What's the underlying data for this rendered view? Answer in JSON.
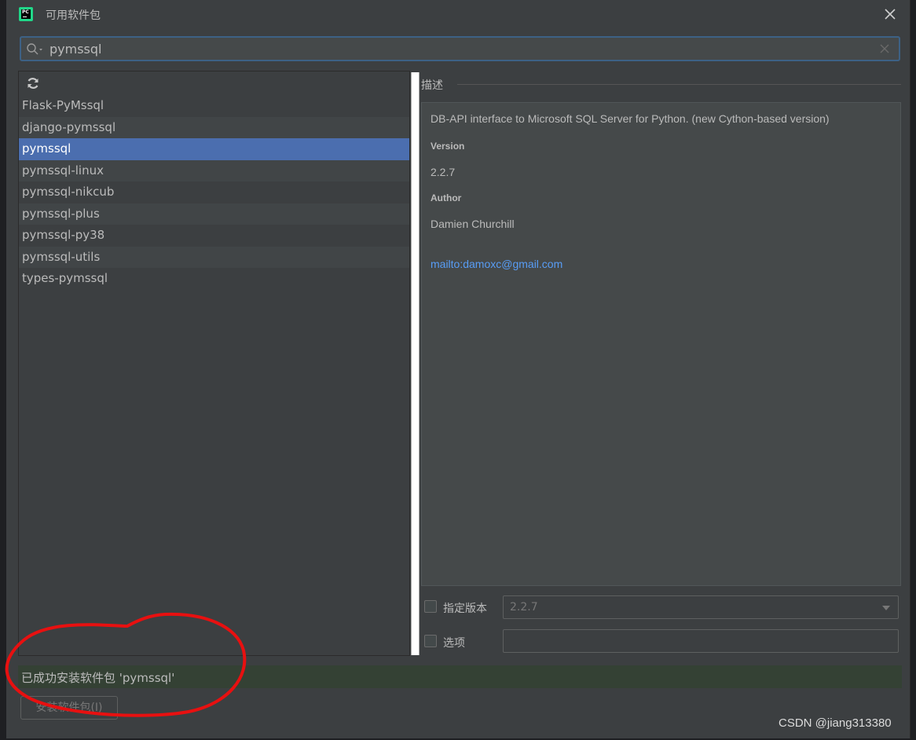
{
  "window": {
    "title": "可用软件包",
    "app_icon_text": "PC"
  },
  "search": {
    "value": "pymssql"
  },
  "packages": [
    {
      "name": "Flask-PyMssql"
    },
    {
      "name": "django-pymssql"
    },
    {
      "name": "pymssql",
      "selected": true
    },
    {
      "name": "pymssql-linux"
    },
    {
      "name": "pymssql-nikcub"
    },
    {
      "name": "pymssql-plus"
    },
    {
      "name": "pymssql-py38"
    },
    {
      "name": "pymssql-utils"
    },
    {
      "name": "types-pymssql"
    }
  ],
  "description": {
    "header": "描述",
    "summary": "DB-API interface to Microsoft SQL Server for Python. (new Cython-based version)",
    "version_label": "Version",
    "version_value": "2.2.7",
    "author_label": "Author",
    "author_value": "Damien Churchill",
    "author_email": "mailto:damoxc@gmail.com"
  },
  "options": {
    "specify_version_label": "指定版本",
    "specify_version_checked": false,
    "version_selected": "2.2.7",
    "options_label": "选项",
    "options_checked": false,
    "options_value": ""
  },
  "status": {
    "message": "已成功安装软件包 'pymssql'"
  },
  "footer": {
    "install_button": "安装软件包(I)"
  },
  "watermark": "CSDN @jiang313380",
  "colors": {
    "selection": "#4b6eaf",
    "status_success_bg": "#344134",
    "link": "#589df6",
    "annotation": "#e81010"
  }
}
